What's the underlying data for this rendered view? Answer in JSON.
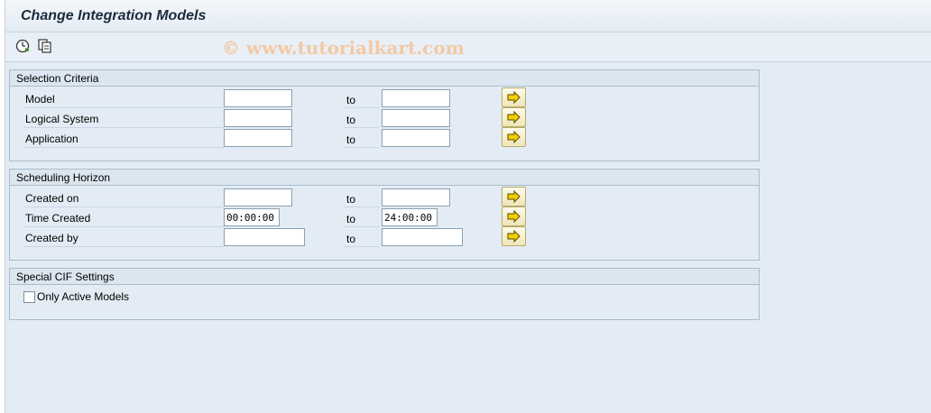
{
  "window": {
    "title": "Change Integration Models",
    "watermark": "© www.tutorialkart.com"
  },
  "toolbar": {
    "buttons": [
      {
        "name": "execute",
        "icon": "clock-execute-icon"
      },
      {
        "name": "variants",
        "icon": "get-variant-icon"
      }
    ]
  },
  "selection_criteria": {
    "header": "Selection Criteria",
    "rows": [
      {
        "label": "Model",
        "to": "to",
        "low": "",
        "high": ""
      },
      {
        "label": "Logical System",
        "to": "to",
        "low": "",
        "high": ""
      },
      {
        "label": "Application",
        "to": "to",
        "low": "",
        "high": ""
      }
    ]
  },
  "scheduling_horizon": {
    "header": "Scheduling Horizon",
    "rows": [
      {
        "label": "Created on",
        "to": "to",
        "low": "",
        "high": ""
      },
      {
        "label": "Time Created",
        "to": "to",
        "low": "00:00:00",
        "high": "24:00:00"
      },
      {
        "label": "Created by",
        "to": "to",
        "low": "",
        "high": ""
      }
    ]
  },
  "special_cif": {
    "header": "Special CIF Settings",
    "checkbox_label": "Only Active Models",
    "checked": false
  },
  "colors": {
    "background": "#e3ecf4",
    "group_border": "#a9bcce",
    "watermark": "#f3c9a4",
    "arrow": "#f2d000"
  }
}
